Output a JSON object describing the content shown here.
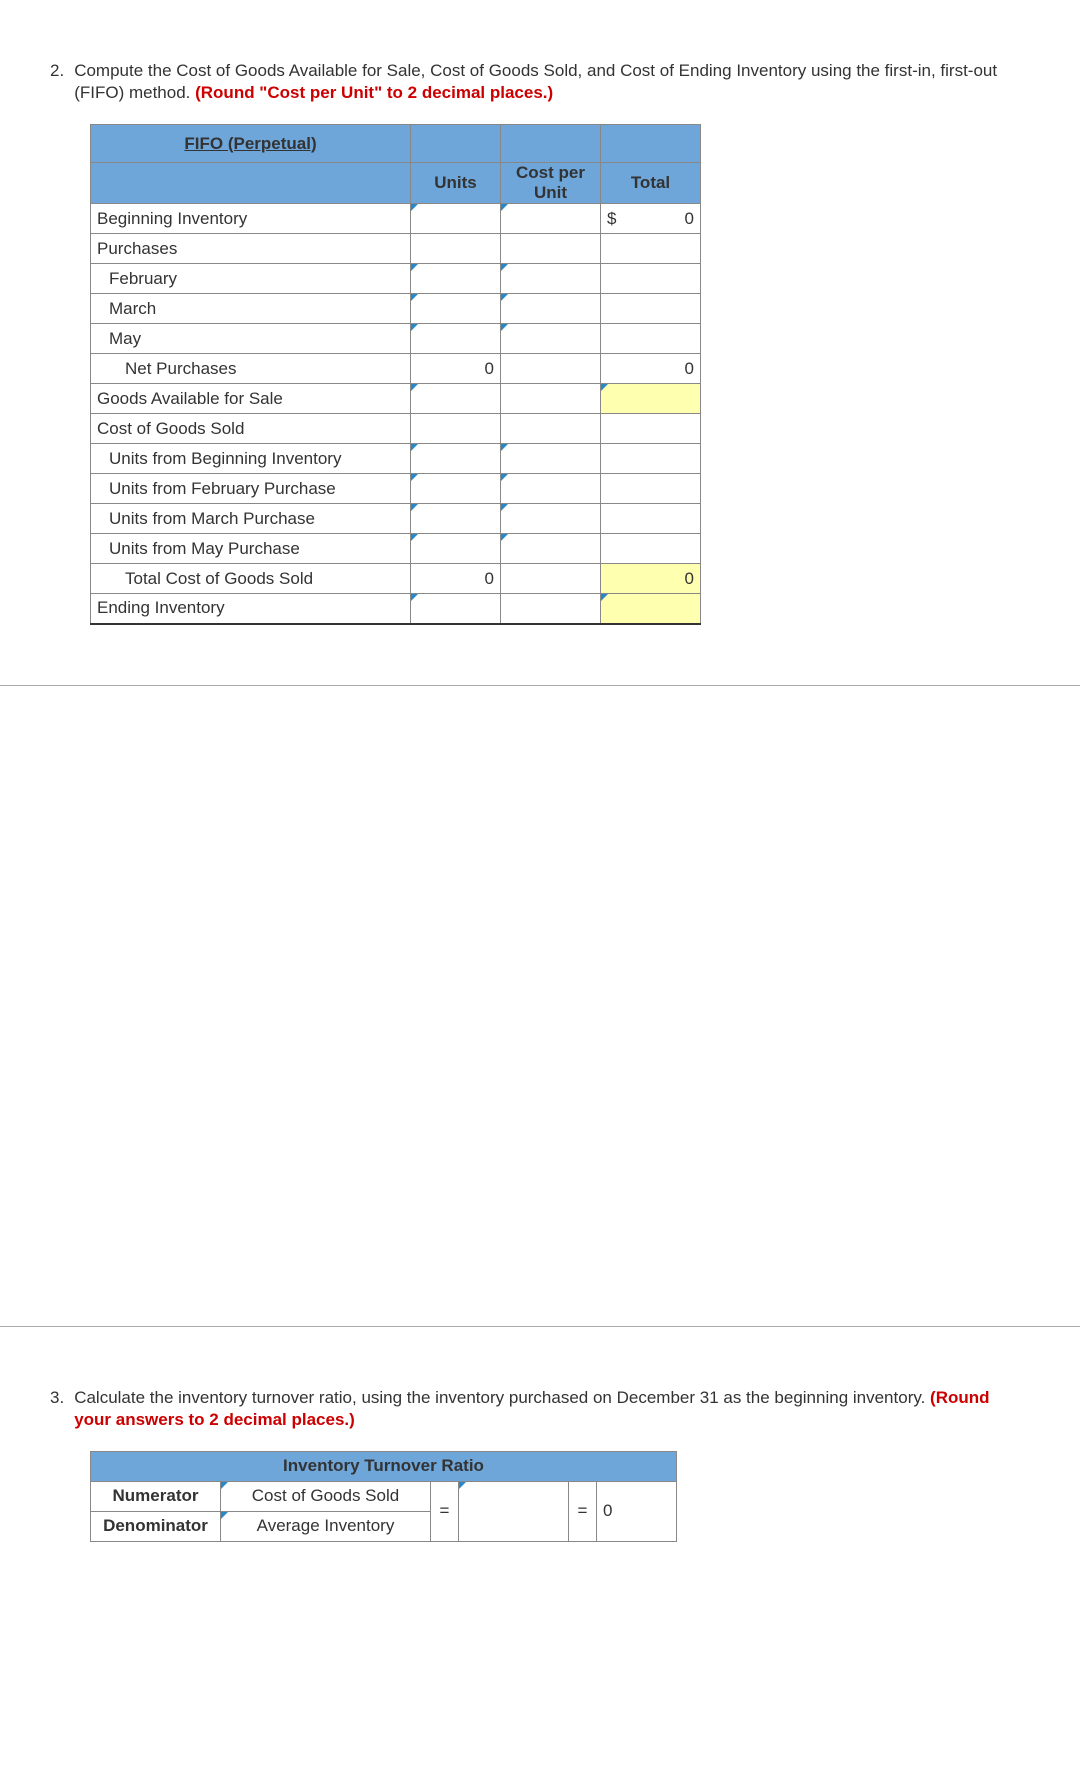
{
  "q2": {
    "number": "2.",
    "text_a": "Compute the Cost of Goods Available for Sale, Cost of Goods Sold, and Cost of Ending Inventory using the first-in, first-out (FIFO) method. ",
    "text_red": "(Round \"Cost per Unit\" to 2 decimal places.)"
  },
  "fifo": {
    "title": "FIFO (Perpetual)",
    "headers": {
      "units": "Units",
      "cpu": "Cost per Unit",
      "total": "Total"
    },
    "rows": {
      "beg_inv": "Beginning Inventory",
      "purchases": "Purchases",
      "feb": "February",
      "mar": "March",
      "may": "May",
      "net_purch": "Net Purchases",
      "gafs": "Goods Available for Sale",
      "cogs": "Cost of Goods Sold",
      "from_beg": "Units from Beginning Inventory",
      "from_feb": "Units from February Purchase",
      "from_mar": "Units from March Purchase",
      "from_may": "Units from May Purchase",
      "total_cogs": "Total Cost of Goods Sold",
      "end_inv": "Ending Inventory"
    },
    "values": {
      "beg_total_prefix": "$",
      "beg_total": "0",
      "net_purch_units": "0",
      "net_purch_total": "0",
      "total_cogs_units": "0",
      "total_cogs_total": "0"
    }
  },
  "q3": {
    "number": "3.",
    "text_a": "Calculate the inventory turnover ratio, using the inventory purchased on December 31 as the beginning inventory. ",
    "text_red": "(Round your answers to 2 decimal places.)"
  },
  "ratio": {
    "title": "Inventory Turnover Ratio",
    "numerator_label": "Numerator",
    "denominator_label": "Denominator",
    "numerator_desc": "Cost of Goods Sold",
    "denominator_desc": "Average Inventory",
    "eq": "=",
    "result": "0"
  }
}
